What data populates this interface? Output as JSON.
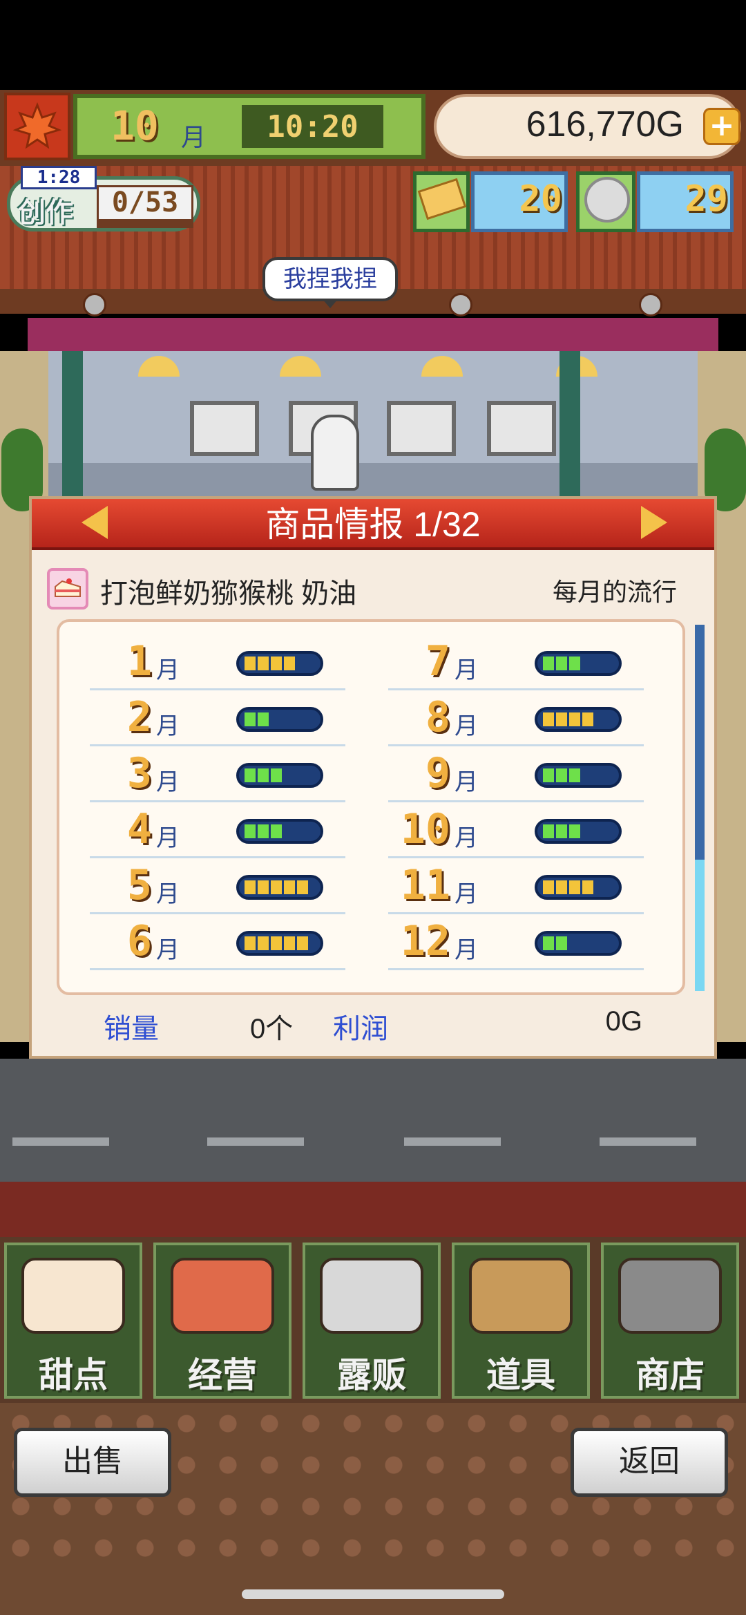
{
  "hud": {
    "month": "10",
    "month_unit": "月",
    "time": "10:20",
    "gold": "616,770G",
    "plus": "+"
  },
  "create": {
    "label": "创作",
    "timer": "1:28",
    "count": "0/53"
  },
  "resources": {
    "tickets": "20",
    "medals": "29"
  },
  "bubble": {
    "text": "我捏我捏"
  },
  "panel": {
    "title": "商品情报 1/32",
    "item_name": "打泡鲜奶猕猴桃 奶油",
    "trend_label": "每月的流行",
    "months": [
      {
        "month": "1",
        "unit": "月",
        "level": 4,
        "max": 5
      },
      {
        "month": "2",
        "unit": "月",
        "level": 2,
        "max": 5
      },
      {
        "month": "3",
        "unit": "月",
        "level": 3,
        "max": 5
      },
      {
        "month": "4",
        "unit": "月",
        "level": 3,
        "max": 5
      },
      {
        "month": "5",
        "unit": "月",
        "level": 5,
        "max": 5
      },
      {
        "month": "6",
        "unit": "月",
        "level": 5,
        "max": 5
      },
      {
        "month": "7",
        "unit": "月",
        "level": 3,
        "max": 5
      },
      {
        "month": "8",
        "unit": "月",
        "level": 4,
        "max": 5
      },
      {
        "month": "9",
        "unit": "月",
        "level": 3,
        "max": 5
      },
      {
        "month": "10",
        "unit": "月",
        "level": 3,
        "max": 5
      },
      {
        "month": "11",
        "unit": "月",
        "level": 4,
        "max": 5
      },
      {
        "month": "12",
        "unit": "月",
        "level": 2,
        "max": 5
      }
    ],
    "sales_label": "销量",
    "sales_value": "0个",
    "profit_label": "利润",
    "profit_value": "0G"
  },
  "menu": {
    "items": [
      {
        "label": "甜点",
        "icon": "cake-icon"
      },
      {
        "label": "经营",
        "icon": "shop-icon"
      },
      {
        "label": "露贩",
        "icon": "food-truck-icon"
      },
      {
        "label": "道具",
        "icon": "item-bag-icon"
      },
      {
        "label": "商店",
        "icon": "shopping-cart-icon"
      }
    ]
  },
  "footer": {
    "sell": "出售",
    "back": "返回"
  },
  "colors": {
    "bar_green": "#6ee04a",
    "bar_yellow": "#f3c43a",
    "header_red": "#c8301e",
    "label_blue": "#2e4ed2"
  }
}
